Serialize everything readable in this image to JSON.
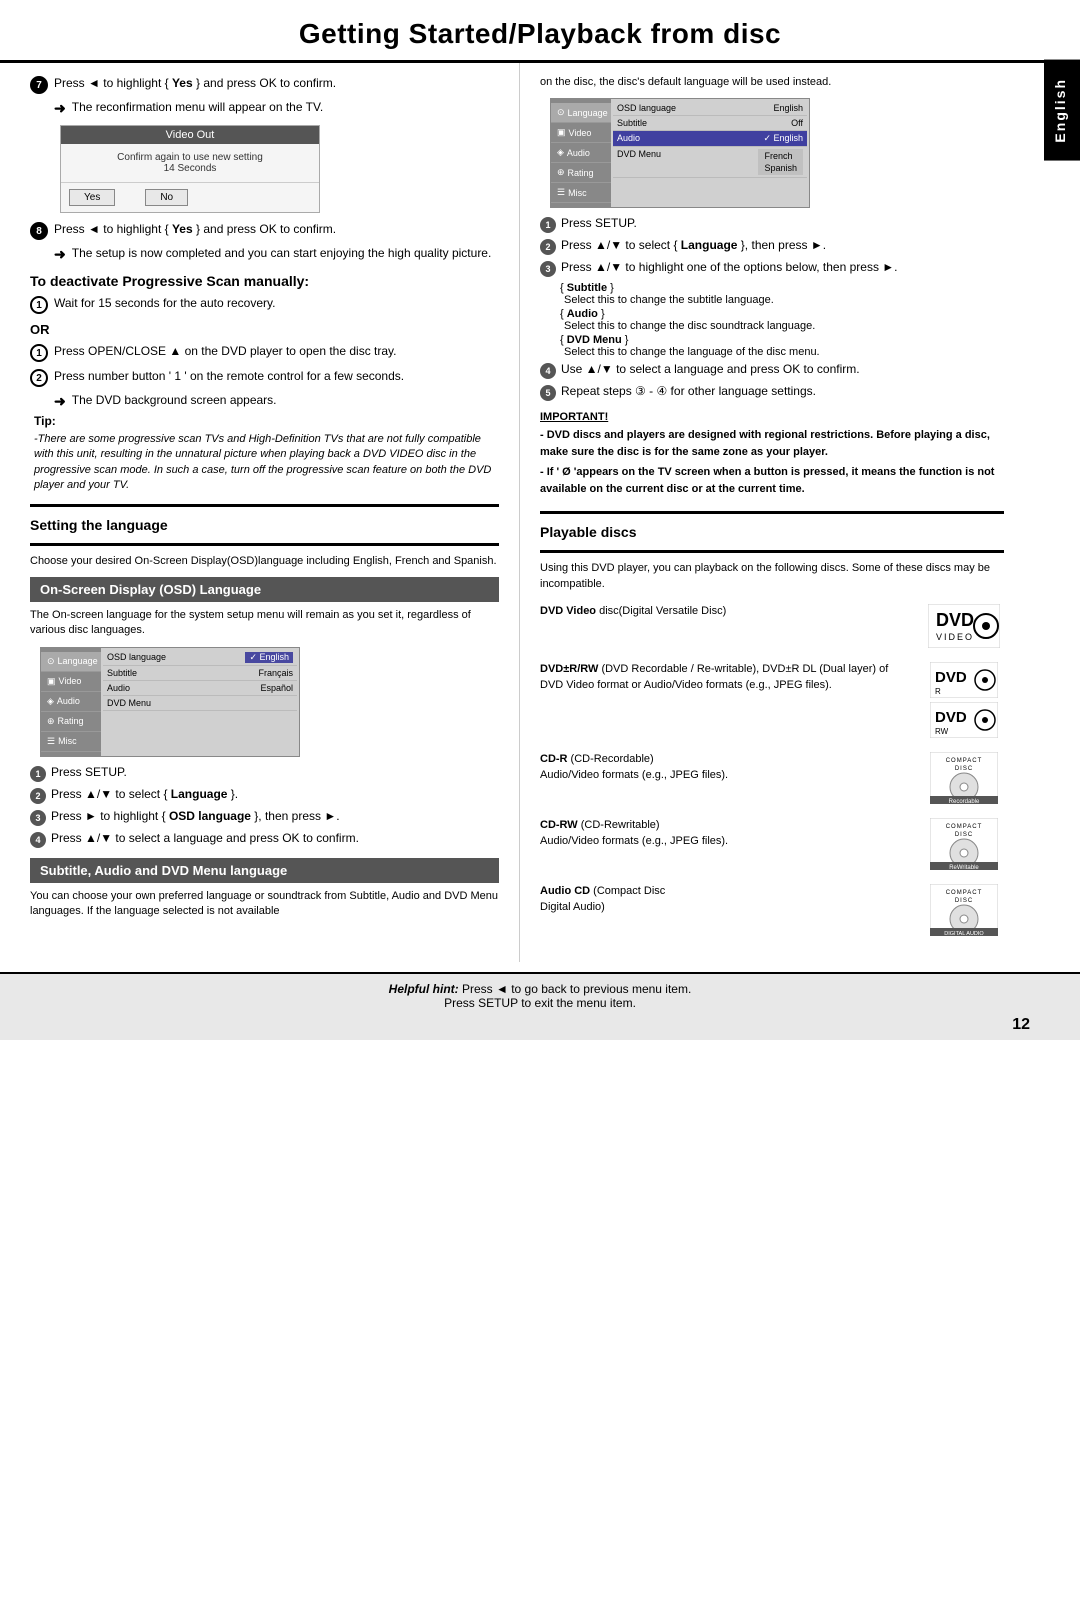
{
  "page": {
    "title": "Getting Started/Playback from disc",
    "page_number": "12",
    "side_tab": "English"
  },
  "left_col": {
    "step7": {
      "text": "Press ◄ to highlight { Yes } and press OK to confirm.",
      "arrow_text": "The reconfirmation menu will appear on the TV."
    },
    "screen1": {
      "header": "Video Out",
      "confirm_line1": "Confirm again to use new setting",
      "confirm_line2": "14 Seconds",
      "btn_yes": "Yes",
      "btn_no": "No"
    },
    "step8": {
      "text": "Press ◄ to highlight { Yes } and press OK to confirm.",
      "arrow_text": "The setup is now completed and you can start enjoying the high quality picture."
    },
    "deactivate_title": "To deactivate Progressive Scan manually:",
    "deactivate_step1": "Wait for 15 seconds for the auto recovery.",
    "or_label": "OR",
    "or_step1": "Press OPEN/CLOSE ▲ on the DVD player to open the disc tray.",
    "or_step2": "Press number button ' 1 ' on the remote  control for a few seconds.",
    "or_step2_arrow": "The DVD background screen appears.",
    "tip_label": "Tip:",
    "tip_text": "-There are some progressive scan TVs and High-Definition TVs that are not fully compatible with this unit, resulting in the unnatural picture when playing back a DVD VIDEO disc in the progressive scan mode. In such a case, turn off the progressive scan feature on both the DVD player and your TV.",
    "setting_language_title": "Setting the language",
    "setting_language_desc": "Choose your desired On-Screen Display(OSD)language including English, French and Spanish.",
    "osd_header": "On-Screen Display (OSD) Language",
    "osd_desc": "The On-screen language for the system setup menu will remain as you set it, regardless of various disc languages.",
    "menu2": {
      "sidebar_items": [
        "Language",
        "Video",
        "Audio",
        "Rating",
        "Misc"
      ],
      "content_rows": [
        {
          "label": "OSD language",
          "value": "✓ English"
        },
        {
          "label": "Subtitle",
          "value": "Français"
        },
        {
          "label": "Audio",
          "value": "Español"
        },
        {
          "label": "DVD Menu",
          "value": ""
        }
      ]
    },
    "setup_steps": [
      "Press SETUP.",
      "Press ▲/▼ to select { Language }.",
      "Press ► to highlight { OSD language }, then press ►.",
      "Press ▲/▼ to select a language and press OK to confirm."
    ],
    "subtitle_header": "Subtitle, Audio and DVD Menu language",
    "subtitle_desc": "You can choose your own preferred language or soundtrack from Subtitle, Audio and DVD Menu languages. If the language selected is not available"
  },
  "right_col": {
    "osd_desc2": "on the disc, the disc's default language will be used instead.",
    "menu3": {
      "sidebar_items": [
        "Language",
        "Video",
        "Audio",
        "Rating",
        "Misc"
      ],
      "content_rows": [
        {
          "label": "OSD language",
          "value": "English"
        },
        {
          "label": "Subtitle",
          "value": "Off"
        },
        {
          "label": "Audio",
          "value": "✓ English"
        },
        {
          "label": "DVD Menu",
          "value": "French"
        },
        {
          "label": "",
          "value": "Spanish"
        }
      ]
    },
    "setup_steps": [
      "Press SETUP.",
      "Press ▲/▼ to select { Language }, then press ►.",
      "Press ▲/▼ to highlight one of the options below, then press ►.",
      "{ Subtitle }",
      "Select this to change the subtitle language.",
      "{ Audio }",
      "Select this to change the disc soundtrack language.",
      "{ DVD Menu }",
      "Select this to change the language of the disc menu.",
      "Use ▲/▼ to select a language and press OK to confirm.",
      "Repeat steps ③ - ④ for other language settings."
    ],
    "important_title": "IMPORTANT!",
    "important_lines": [
      "- DVD discs and players are designed with regional restrictions.  Before playing a disc, make sure the disc is for the same zone as your player.",
      "- If ' Ø 'appears on the TV screen when a button is pressed, it means the function is not available on the current disc or at the current time."
    ],
    "playable_discs_title": "Playable discs",
    "playable_desc": "Using this DVD player, you can playback on the following discs. Some of these discs may be incompatible.",
    "discs": [
      {
        "name": "DVD Video",
        "desc": "DVD Video disc(Digital Versatile Disc)",
        "logo_type": "dvd-video"
      },
      {
        "name": "DVD±R/RW",
        "desc": "DVD±R/RW (DVD Recordable / Re-writable), DVD±R DL (Dual layer) of DVD Video format or Audio/Video formats (e.g., JPEG files).",
        "logo_type": "dvd-r-rw"
      },
      {
        "name": "CD-R",
        "desc": "CD-R (CD-Recordable)\nAudio/Video formats (e.g., JPEG files).",
        "logo_type": "cd-r"
      },
      {
        "name": "CD-RW",
        "desc": "CD-RW (CD-Rewritable)\nAudio/Video formats (e.g., JPEG files).",
        "logo_type": "cd-rw"
      },
      {
        "name": "Audio CD",
        "desc": "Audio CD (Compact Disc\nDigital Audio)",
        "logo_type": "cd-audio"
      }
    ]
  },
  "bottom": {
    "helpful_hint_label": "Helpful hint:",
    "hint_line1": "Press ◄ to go back to previous menu item.",
    "hint_line2": "Press SETUP to exit the menu item."
  }
}
